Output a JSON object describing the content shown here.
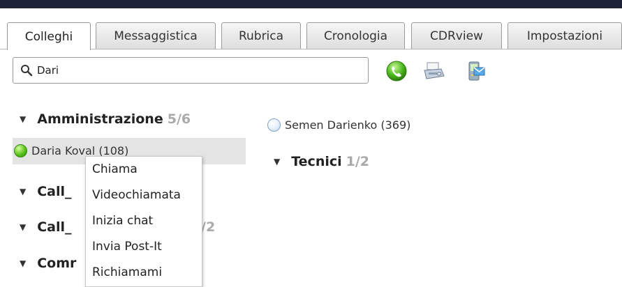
{
  "tabs": [
    {
      "label": "Colleghi",
      "active": true
    },
    {
      "label": "Messaggistica"
    },
    {
      "label": "Rubrica"
    },
    {
      "label": "Cronologia"
    },
    {
      "label": "CDRview"
    },
    {
      "label": "Impostazioni"
    }
  ],
  "search": {
    "value": "Dari"
  },
  "toolbar": {
    "icons": [
      "phone-call-icon",
      "fax-icon",
      "sms-icon"
    ]
  },
  "groups": [
    {
      "name": "Amministrazione",
      "count": "5/6"
    },
    {
      "name": "Call_"
    },
    {
      "name": "Call_",
      "count": "/2"
    },
    {
      "name": "Comr"
    },
    {
      "name": "Tecnici",
      "count": "1/2"
    }
  ],
  "contacts": [
    {
      "name": "Daria Koval (108)",
      "status": "online",
      "color": "#58c21c"
    },
    {
      "name": "Semen Darienko (369)",
      "status": "offline",
      "color": "#e6f0fb"
    }
  ],
  "context_menu": {
    "items": [
      "Chiama",
      "Videochiamata",
      "Inizia chat",
      "Invia Post-It",
      "Richiamami"
    ]
  }
}
